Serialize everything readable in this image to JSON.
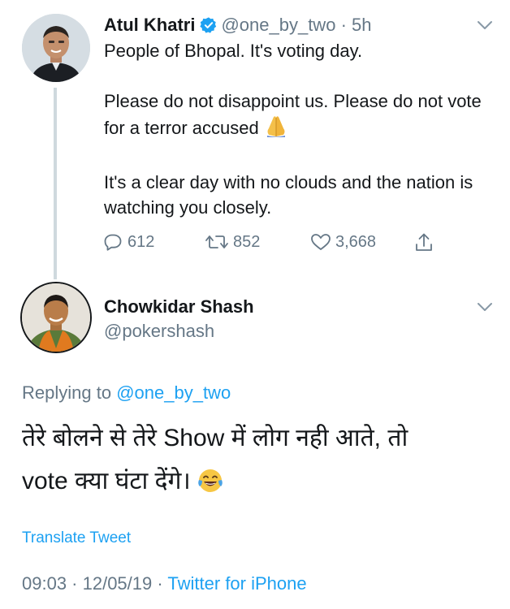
{
  "tweet1": {
    "author_name": "Atul Khatri",
    "handle": "@one_by_two",
    "separator": "·",
    "time": "5h",
    "paragraphs": [
      "People of Bhopal. It's voting day.",
      "Please do not disappoint us. Please do not vote for a terror accused",
      "It's a clear day with no clouds and the nation is watching you closely."
    ],
    "emoji": "folded-hands",
    "stats": {
      "replies": "612",
      "retweets": "852",
      "likes": "3,668"
    }
  },
  "tweet2": {
    "author_name": "Chowkidar Shash",
    "handle": "@pokershash",
    "replying_prefix": "Replying to",
    "replying_to": "@one_by_two",
    "body_line1": "तेरे बोलने से तेरे Show में लोग नही आते, तो",
    "body_line2": "vote क्या घंटा देंगे।",
    "emoji": "face-with-tears-of-joy",
    "translate_label": "Translate Tweet",
    "timestamp": "09:03 · 12/05/19",
    "footer_separator": "·",
    "source": "Twitter for iPhone"
  },
  "colors": {
    "link": "#1da1f2",
    "muted": "#657786",
    "text": "#14171a",
    "thread_line": "#cfd9de"
  }
}
